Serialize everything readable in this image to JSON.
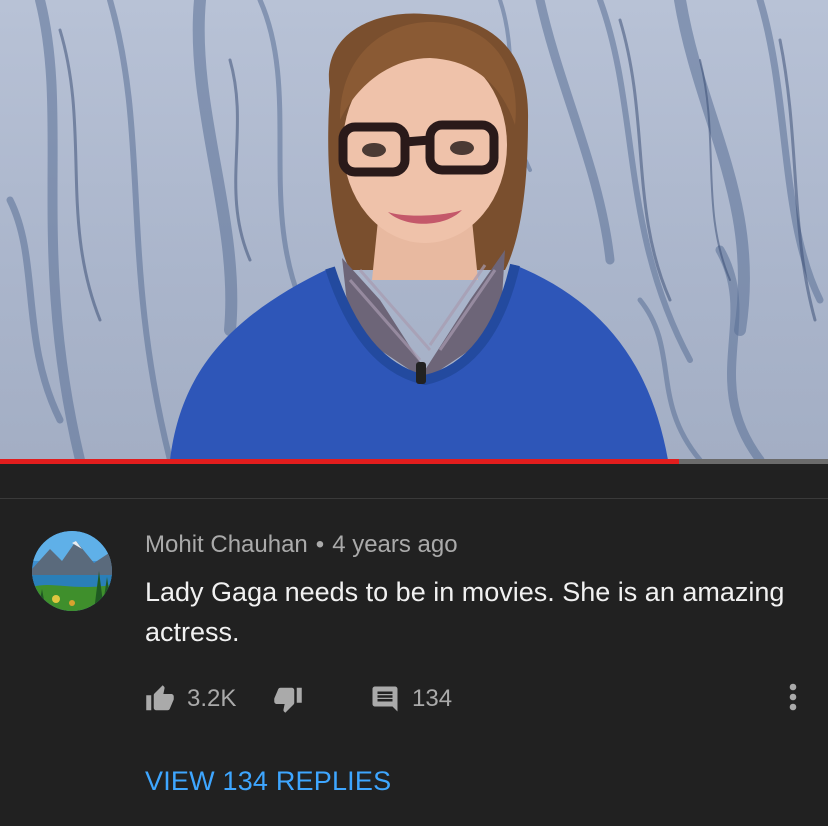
{
  "video": {
    "progress_fraction": 0.82
  },
  "comment": {
    "author": "Mohit Chauhan",
    "separator": "•",
    "timestamp": "4 years ago",
    "text": "Lady Gaga needs to be in movies. She is an amazing actress.",
    "likes": "3.2K",
    "reply_count": "134",
    "view_replies_label": "VIEW 134 REPLIES"
  },
  "icons": {
    "like": "thumbs-up-icon",
    "dislike": "thumbs-down-icon",
    "reply": "comment-icon",
    "more": "more-vert-icon"
  },
  "colors": {
    "background": "#212121",
    "progress": "#e11d1d",
    "link": "#3ea6ff",
    "text_primary": "#f1f1f1",
    "text_secondary": "#aaaaaa"
  }
}
